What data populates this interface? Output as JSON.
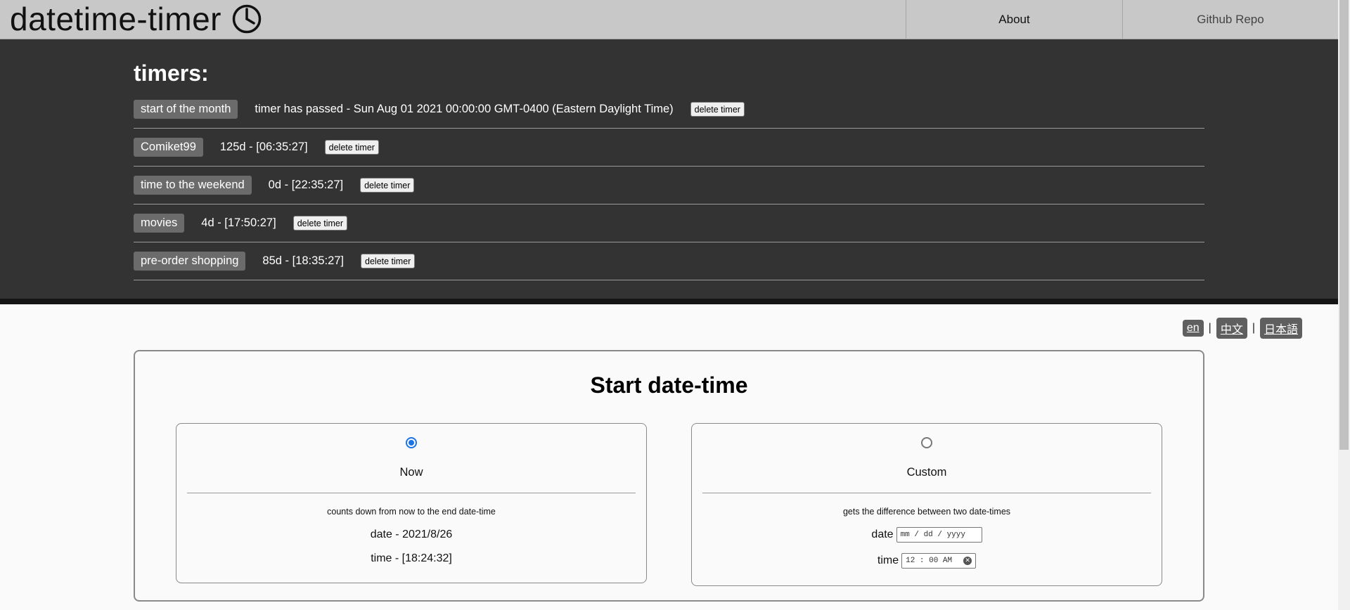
{
  "header": {
    "title": "datetime-timer",
    "icon": "clock-icon",
    "nav": {
      "about": "About",
      "github": "Github Repo"
    }
  },
  "timers": {
    "heading": "timers:",
    "delete_label": "delete timer",
    "items": [
      {
        "name": "start of the month",
        "value": "timer has passed - Sun Aug 01 2021 00:00:00 GMT-0400 (Eastern Daylight Time)"
      },
      {
        "name": "Comiket99",
        "value": "125d - [06:35:27]"
      },
      {
        "name": "time to the weekend",
        "value": "0d - [22:35:27]"
      },
      {
        "name": "movies",
        "value": "4d - [17:50:27]"
      },
      {
        "name": "pre-order shopping",
        "value": "85d - [18:35:27]"
      }
    ]
  },
  "languages": {
    "en": "en",
    "zh": "中文",
    "ja": "日本語",
    "separator": "|"
  },
  "start_card": {
    "title": "Start date-time",
    "now": {
      "label": "Now",
      "checked": true,
      "description": "counts down from now to the end date-time",
      "date": "date - 2021/8/26",
      "time": "time - [18:24:32]"
    },
    "custom": {
      "label": "Custom",
      "checked": false,
      "description": "gets the difference between two date-times",
      "date_label": "date",
      "date_placeholder": "mm / dd / yyyy",
      "time_label": "time",
      "time_value": "12 : 00  AM"
    }
  }
}
